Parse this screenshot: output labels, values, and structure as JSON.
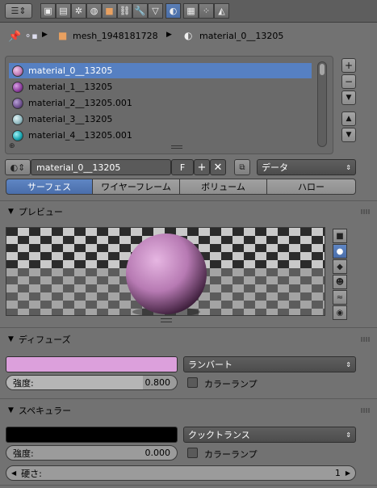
{
  "header": {
    "editor_icon": "properties-editor-icon",
    "context_icons": [
      "render-icon",
      "render-layers-icon",
      "scene-icon",
      "world-icon",
      "object-icon",
      "constraints-icon",
      "modifiers-icon",
      "object-data-icon",
      "material-icon",
      "texture-icon",
      "particles-icon",
      "physics-icon"
    ],
    "active_context": "material-icon"
  },
  "breadcrumb": {
    "pin_icon": "pin-icon",
    "object_name": "mesh_1948181728",
    "material_name": "material_0__13205"
  },
  "material_slots": {
    "items": [
      {
        "label": "material_0__13205",
        "color": "#c07ab6",
        "selected": true
      },
      {
        "label": "material_1__13205",
        "color": "#8b3c9c",
        "selected": false
      },
      {
        "label": "material_2__13205.001",
        "color": "#6a4d8a",
        "selected": false
      },
      {
        "label": "material_3__13205",
        "color": "#8fb6bd",
        "selected": false
      },
      {
        "label": "material_4__13205.001",
        "color": "#16a2ad",
        "selected": false
      }
    ],
    "add_label": "+",
    "remove_label": "−",
    "up_label": "▲",
    "down_label": "▼"
  },
  "datablock": {
    "name": "material_0__13205",
    "fake_user": "F",
    "link_type": "データ"
  },
  "tabs": [
    {
      "label": "サーフェス",
      "active": true
    },
    {
      "label": "ワイヤーフレーム",
      "active": false
    },
    {
      "label": "ボリューム",
      "active": false
    },
    {
      "label": "ハロー",
      "active": false
    }
  ],
  "preview": {
    "title": "プレビュー",
    "sphere_color": "#b77ab3"
  },
  "diffuse": {
    "title": "ディフューズ",
    "color": "#dca0dc",
    "shader": "ランバート",
    "intensity_label": "強度:",
    "intensity_value": "0.800",
    "ramp_label": "カラーランプ"
  },
  "specular": {
    "title": "スペキュラー",
    "color": "#000000",
    "shader": "クックトランス",
    "intensity_label": "強度:",
    "intensity_value": "0.000",
    "ramp_label": "カラーランプ",
    "hardness_label": "硬さ:",
    "hardness_value": "1"
  }
}
